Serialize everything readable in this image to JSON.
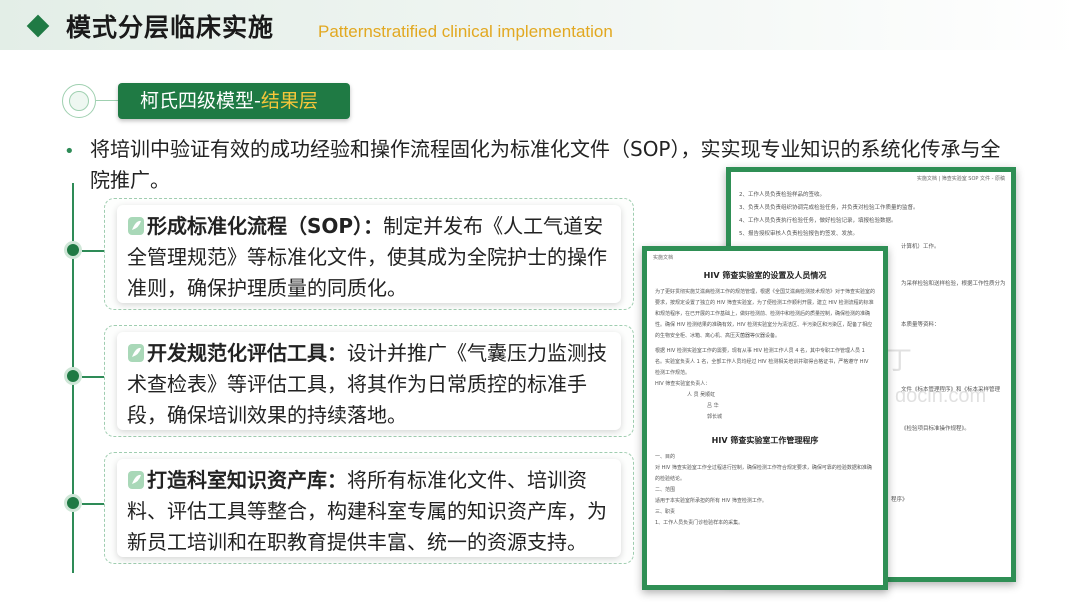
{
  "header": {
    "title": "模式分层临床实施",
    "subtitle": "Patternstratified clinical implementation"
  },
  "section_tag": {
    "label_part1": "柯氏四级模型-",
    "label_part2": "结果层"
  },
  "intro": "将培训中验证有效的成功经验和操作流程固化为标准化文件（SOP），实实现专业知识的系统化传承与全院推广。",
  "cards": [
    {
      "icon": "leaf-icon",
      "title": "形成标准化流程（SOP）：",
      "text": "制定并发布《人工气道安全管理规范》等标准化文件，使其成为全院护士的操作准则，确保护理质量的同质化。"
    },
    {
      "icon": "leaf-icon",
      "title": "开发规范化评估工具：",
      "text": "设计并推广《气囊压力监测技术查检表》等评估工具，将其作为日常质控的标准手段，确保培训效果的持续落地。"
    },
    {
      "icon": "leaf-icon",
      "title": "打造科室知识资产库：",
      "text": "将所有标准化文件、培训资料、评估工具等整合，构建科室专属的知识资产库，为新员工培训和在职教育提供丰富、统一的资源支持。"
    }
  ],
  "doc_back": {
    "header": "实施文档 | 筛查实验室 SOP 文件 - 原稿",
    "lines": [
      "2、工作人员负责检验样品的签收。",
      "3、负责人员负责组织协调完成检验任务，并负责对检验工作质量的监督。",
      "4、工作人员负责执行检验任务，做好检验记录，填报检验数据。",
      "5、报告授权审核人负责检验报告的签发、发放。",
      "计算机）工作。",
      "为采样检验和送样检验，根据工作性质分为",
      "本质量等资料：",
      "文件《标本管理程序》和《标本采样管理",
      "《检验项目标准操作规程》。",
      "程序》"
    ]
  },
  "doc_front": {
    "header": "实施文档",
    "title1": "HIV 筛查实验室的设置及人员情况",
    "para1": "为了更好贯彻实施艾滋病检测工作的规范管理，根据《全国艾滋病检测技术规范》对于筛查实验室的要求，按规定设置了独立的 HIV 筛查实验室，为了便检测工作顺利开展，建立 HIV 检测流程的标准和规范程序，在已开展的工作基础上，做好检测前、检测中和检测后的质量控制，确保检测的准确性。确保 HIV 检测结果的准确有效，HIV 检测实验室分为清洁区、半污染区和污染区，配备了相应的生物安全柜、冰箱、离心机、高压灭菌器等仪器设备。",
    "para2": "根据 HIV 检测实验室工作的需要，现有从事 HIV 检测工作人员 4 名，其中专职工作管理人员 1 名。实验室负责人 1 名，全部工作人员均经过 HIV 检测相关培训并取得合格证书，严格遵守 HIV 检测工作规范。",
    "signatures": [
      "HIV 筛查实验室负责人：",
      "人 员  吴顺虹",
      "吕 华",
      "郭长城"
    ],
    "title2": "HIV 筛查实验室工作管理程序",
    "section_items": [
      "一、目的",
      "对 HIV 筛查实验室工作全过程进行控制，确保检测工作符合规定要求，确保可靠的检验数据和准确的检验结论。",
      "二、范围",
      "适用于本实验室所承担的所有 HIV 筛查检测工作。",
      "三、职责",
      "1、工作人员负责门诊检验样本的采集。"
    ]
  },
  "watermarks": {
    "brand": "豆丁",
    "url": "docin.com"
  },
  "colors": {
    "accent_green": "#1f7a44",
    "highlight_yellow": "#f5c63a",
    "subtitle_gold": "#e2a820"
  }
}
